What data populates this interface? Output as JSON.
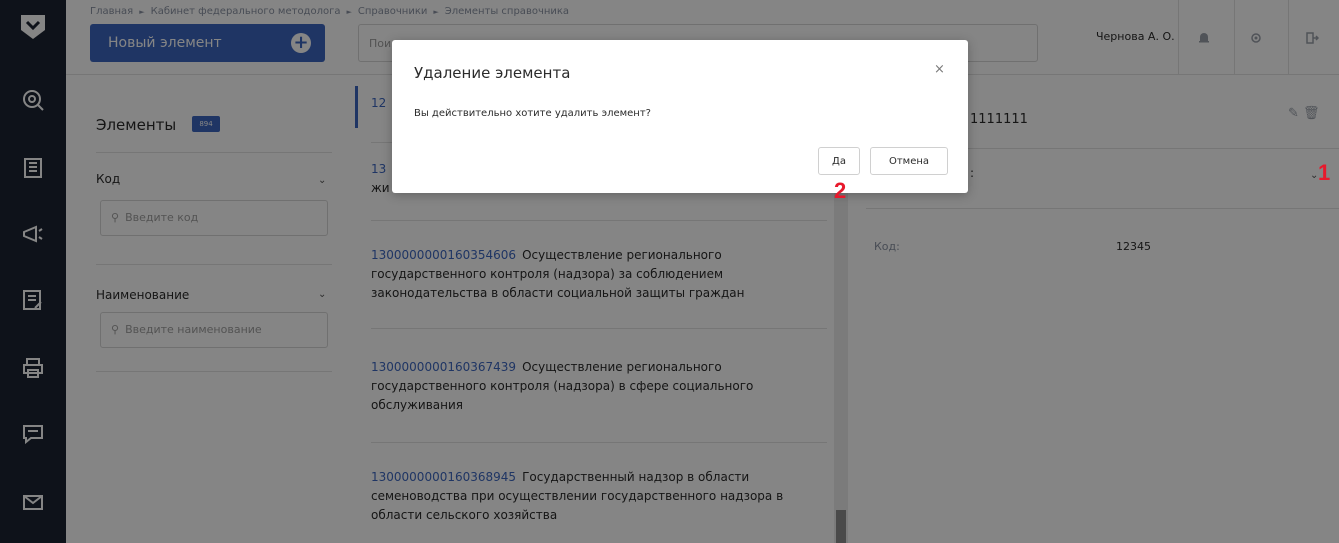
{
  "breadcrumbs": [
    "Главная",
    "Кабинет федерального методолога",
    "Справочники",
    "Элементы справочника"
  ],
  "header": {
    "new_element_label": "Новый элемент",
    "search_placeholder": "Пои",
    "user_name": "Чернова А. О.",
    "icons": [
      "bell-icon",
      "gear-icon",
      "logout-icon"
    ]
  },
  "nav_icons": [
    "logo-icon",
    "search-icon",
    "building-icon",
    "megaphone-icon",
    "checklist-icon",
    "printer-icon",
    "chat-icon",
    "mail-icon"
  ],
  "filters": {
    "title": "Элементы",
    "count": "894",
    "code_label": "Код",
    "code_placeholder": "Введите код",
    "name_label": "Наименование",
    "name_placeholder": "Введите наименование"
  },
  "list": {
    "items": [
      {
        "code": "12",
        "text": ""
      },
      {
        "code": "13",
        "text": "жи"
      },
      {
        "code": "1300000000160354606",
        "text": "Осуществление регионального государственного контроля (надзора) за соблюдением законодательства в области социальной защиты граждан"
      },
      {
        "code": "1300000000160367439",
        "text": "Осуществление регионального государственного контроля (надзора) в сфере социального обслуживания"
      },
      {
        "code": "1300000000160368945",
        "text": "Государственный надзор в области семеноводства при осуществлении государственного надзора в области сельского хозяйства"
      }
    ]
  },
  "detail": {
    "title": "1111111",
    "section_label": ":",
    "code_key": "Код:",
    "code_value": "12345"
  },
  "modal": {
    "title": "Удаление элемента",
    "close": "×",
    "message": "Вы действительно хотите удалить элемент?",
    "yes_label": "Да",
    "cancel_label": "Отмена"
  },
  "annotations": {
    "step1": "1",
    "step2": "2"
  },
  "colors": {
    "accent": "#3d67c0",
    "rail": "#1c2433",
    "annotation": "#e8192c"
  }
}
